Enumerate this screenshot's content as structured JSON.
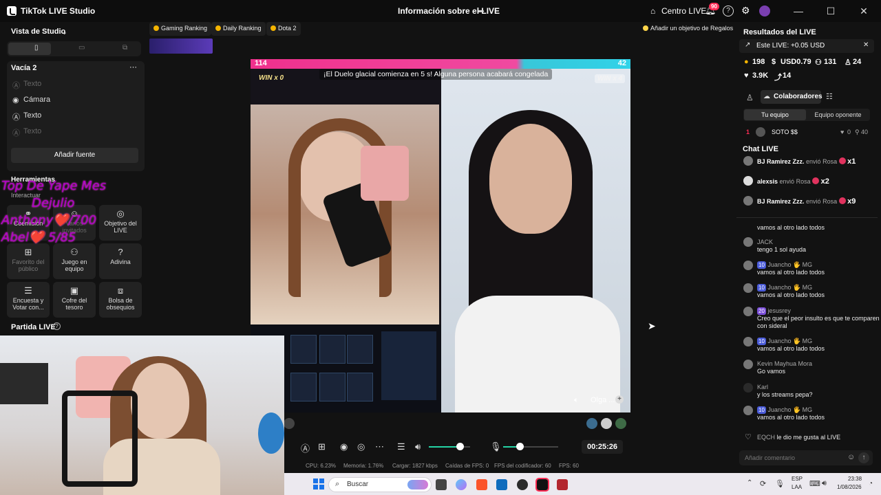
{
  "titlebar": {
    "app_title": "TikTok LIVE Studio",
    "center_title": "Información sobre el LIVE",
    "centro_live": "Centro LIVE",
    "notif_count": "90"
  },
  "left": {
    "studio_view": "Vista de Studio",
    "scene_name": "Vacía 2",
    "sources": [
      "Texto",
      "Cámara",
      "Texto",
      "Texto"
    ],
    "add_source": "Añadir fuente",
    "tools_title": "Herramientas",
    "interact": "Interactuar",
    "tools": [
      {
        "label": "Coemisión"
      },
      {
        "label": "Varios invitados"
      },
      {
        "label": "Objetivo del LIVE"
      },
      {
        "label": "Favorito del público"
      },
      {
        "label": "Juego en equipo"
      },
      {
        "label": "Adivina"
      },
      {
        "label": "Encuesta y Votar con..."
      },
      {
        "label": "Cofre del tesoro"
      },
      {
        "label": "Bolsa de obsequios"
      }
    ],
    "partida": "Partida LIVE"
  },
  "overlay": {
    "line1": "Top De Yape  Mes",
    "line2": "Dejulio",
    "line3": "Anthony❤️/700",
    "line4": "Abel❤️    5/85"
  },
  "top_chips": [
    "Gaming Ranking",
    "Daily Ranking",
    "Dota 2"
  ],
  "goal_button": "Añadir un objetivo de Regalos",
  "battle": {
    "left_score": "114",
    "right_score": "42",
    "left_win": "WIN x 0",
    "right_win": "WIN x 4",
    "banner": "¡El Duelo glacial comienza en 5 s! Alguna persona acabará congelada",
    "guest_name": "Olga ..."
  },
  "controls": {
    "timer": "00:25:26",
    "volume_level": 0.75,
    "mic_level": 0.3
  },
  "stats": [
    "CPU:  6.23%",
    "Memoria:  1.76%",
    "Cargar:  1827 kbps",
    "Caídas de FPS:  0",
    "FPS del codificador:  60",
    "FPS:  60"
  ],
  "right": {
    "results_title": "Resultados del LIVE",
    "this_live": "Este LIVE: +0.05 USD",
    "stats": {
      "coins": "198",
      "usd": "USD0.79",
      "viewers": "131",
      "followers": "24",
      "likes": "3.9K",
      "shares": "14"
    },
    "collab_tab": "Colaboradores",
    "tab_team": "Tu equipo",
    "tab_opponent": "Equipo oponente",
    "contributor": {
      "rank": "1",
      "name": "SOTO $$",
      "hearts": "0",
      "score": "40"
    },
    "chat_title": "Chat LIVE",
    "gifts": [
      {
        "name": "BJ Ramirez Zzz.",
        "text": "envió Rosa",
        "count": "x1"
      },
      {
        "name": "alexsis",
        "text": "envió Rosa",
        "count": "x2"
      },
      {
        "name": "BJ Ramirez Zzz.",
        "text": "envió Rosa",
        "count": "x9"
      }
    ],
    "chat": [
      {
        "name": "",
        "level": "",
        "msg": "vamos al otro lado todos"
      },
      {
        "name": "JACK",
        "level": "",
        "msg": "tengo 1 sol ayuda"
      },
      {
        "name": "Juancho 🖐 MG",
        "level": "10",
        "msg": "vamos al otro lado todos"
      },
      {
        "name": "Juancho 🖐 MG",
        "level": "10",
        "msg": "vamos al otro lado todos"
      },
      {
        "name": "jesusrey",
        "level": "20",
        "msg": "Creo que el peor insulto es que te comparen con sideral"
      },
      {
        "name": "Juancho 🖐 MG",
        "level": "10",
        "msg": "vamos al otro lado todos"
      },
      {
        "name": "Kevin Mayhua Mora",
        "level": "",
        "msg": "Go vamos"
      },
      {
        "name": "Karl",
        "level": "",
        "msg": "y los streams pepa?"
      },
      {
        "name": "Juancho 🖐 MG",
        "level": "10",
        "msg": "vamos al otro lado todos"
      }
    ],
    "like_line": {
      "name": "EQCH",
      "msg": "le dio me gusta al LIVE"
    },
    "comment_placeholder": "Añadir comentario"
  },
  "taskbar": {
    "search": "Buscar",
    "lang1": "ESP",
    "lang2": "LAA",
    "time": "23:38",
    "date": "1/08/2026"
  }
}
